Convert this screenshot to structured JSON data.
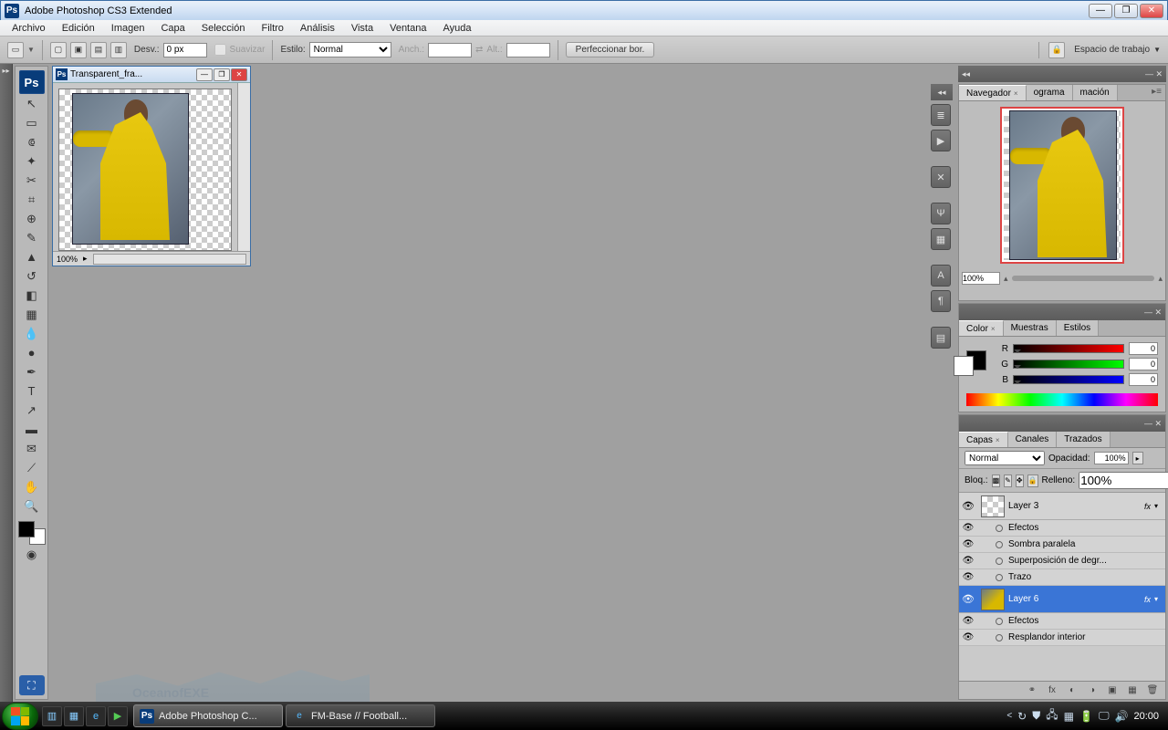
{
  "app": {
    "title": "Adobe Photoshop CS3 Extended"
  },
  "menu": [
    "Archivo",
    "Edición",
    "Imagen",
    "Capa",
    "Selección",
    "Filtro",
    "Análisis",
    "Vista",
    "Ventana",
    "Ayuda"
  ],
  "options": {
    "desv_label": "Desv.:",
    "desv_value": "0 px",
    "suavizar": "Suavizar",
    "estilo_label": "Estilo:",
    "estilo_value": "Normal",
    "anch_label": "Anch.:",
    "alt_label": "Alt.:",
    "perfeccionar": "Perfeccionar bor.",
    "workspace_label": "Espacio de trabajo"
  },
  "document": {
    "title": "Transparent_fra...",
    "zoom": "100%"
  },
  "navigator": {
    "tabs": [
      "Navegador",
      "ograma",
      "mación"
    ],
    "zoom": "100%"
  },
  "color": {
    "tabs": [
      "Color",
      "Muestras",
      "Estilos"
    ],
    "r_label": "R",
    "g_label": "G",
    "b_label": "B",
    "r": "0",
    "g": "0",
    "b": "0"
  },
  "layers": {
    "tabs": [
      "Capas",
      "Canales",
      "Trazados"
    ],
    "mode": "Normal",
    "opacity_label": "Opacidad:",
    "opacity": "100%",
    "lock_label": "Bloq.:",
    "fill_label": "Relleno:",
    "fill": "100%",
    "items": [
      {
        "name": "Layer 3",
        "selected": false,
        "fx": true
      },
      {
        "name": "Layer 6",
        "selected": true,
        "fx": true
      }
    ],
    "effects_label": "Efectos",
    "fx1": [
      "Sombra paralela",
      "Superposición de degr...",
      "Trazo"
    ],
    "fx2": [
      "Resplandor interior"
    ]
  },
  "taskbar": {
    "apps": [
      {
        "label": "Adobe Photoshop C...",
        "icon": "Ps",
        "active": true
      },
      {
        "label": "FM-Base // Football...",
        "icon": "e",
        "active": false
      }
    ],
    "clock": "20:00"
  },
  "watermark": "OceanofEXE"
}
